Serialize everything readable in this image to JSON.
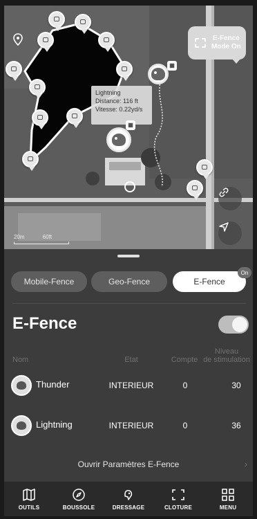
{
  "map": {
    "tooltip": {
      "name": "Lightning",
      "distance": "Distance: 116 ft",
      "speed": "Vitesse: 0.22yd/s"
    },
    "efence_badge": {
      "line1": "E-Fence",
      "line2": "Mode On"
    },
    "scale_labels": [
      "20m",
      "60ft"
    ],
    "icons": {
      "location": "location-pin-icon",
      "link": "link-icon",
      "navigate": "navigation-arrow-icon"
    }
  },
  "panel": {
    "tabs": [
      {
        "label": "Mobile-Fence",
        "active": false
      },
      {
        "label": "Geo-Fence",
        "active": false
      },
      {
        "label": "E-Fence",
        "active": true
      }
    ],
    "on_badge": "On",
    "title": "E-Fence",
    "toggle_on": true,
    "columns": {
      "name": "Nom",
      "state": "Etat",
      "count": "Compte",
      "level_line1": "Niveau",
      "level_line2": "de stimulation"
    },
    "dogs": [
      {
        "name": "Thunder",
        "state": "INTERIEUR",
        "count": "0",
        "level": "30"
      },
      {
        "name": "Lightning",
        "state": "INTERIEUR",
        "count": "0",
        "level": "36"
      }
    ],
    "open_settings": "Ouvrir Paramètres E-Fence"
  },
  "nav": [
    {
      "label": "OUTILS",
      "icon": "map-icon"
    },
    {
      "label": "BOUSSOLE",
      "icon": "compass-icon"
    },
    {
      "label": "DRESSAGE",
      "icon": "training-icon"
    },
    {
      "label": "CLOTURE",
      "icon": "fence-frame-icon"
    },
    {
      "label": "MENU",
      "icon": "grid-menu-icon"
    }
  ],
  "colors": {
    "panel_bg": "#3c3c3c",
    "nav_bg": "#2a2a2a",
    "chip_bg": "#5e5e5e",
    "chip_active": "#ffffff"
  }
}
